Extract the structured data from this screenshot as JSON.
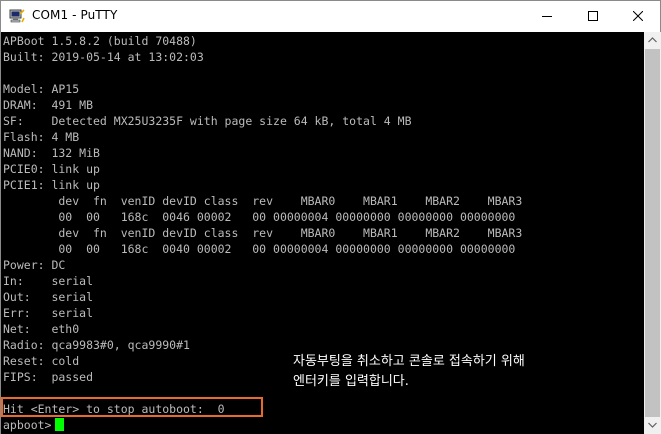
{
  "window": {
    "title": "COM1 - PuTTY",
    "icons": {
      "app": "putty-computer-icon",
      "minimize": "minimize-icon",
      "maximize": "maximize-icon",
      "close": "close-icon"
    }
  },
  "terminal": {
    "background": "#000000",
    "text_color": "#bbbbbb",
    "cursor_color": "#00ff00",
    "lines": [
      "APBoot 1.5.8.2 (build 70488)",
      "Built: 2019-05-14 at 13:02:03",
      "",
      "Model: AP15",
      "DRAM:  491 MB",
      "SF:    Detected MX25U3235F with page size 64 kB, total 4 MB",
      "Flash: 4 MB",
      "NAND:  132 MiB",
      "PCIE0: link up",
      "PCIE1: link up",
      "        dev  fn  venID devID class  rev    MBAR0    MBAR1    MBAR2    MBAR3",
      "        00  00   168c  0046 00002   00 00000004 00000000 00000000 00000000",
      "        dev  fn  venID devID class  rev    MBAR0    MBAR1    MBAR2    MBAR3",
      "        00  00   168c  0040 00002   00 00000004 00000000 00000000 00000000",
      "Power: DC",
      "In:    serial",
      "Out:   serial",
      "Err:   serial",
      "Net:   eth0",
      "Radio: qca9983#0, qca9990#1",
      "Reset: cold",
      "FIPS:  passed",
      "",
      "Hit <Enter> to stop autoboot:  0"
    ],
    "prompt": "apboot>"
  },
  "annotation": {
    "highlight_color": "#e86a2c",
    "text_color": "#ffffff",
    "lines": [
      "자동부팅을 취소하고 콘솔로 접속하기 위해",
      "엔터키를 입력합니다."
    ]
  },
  "scrollbar": {
    "up_icon": "scroll-up-arrow-icon",
    "down_icon": "scroll-down-arrow-icon"
  }
}
